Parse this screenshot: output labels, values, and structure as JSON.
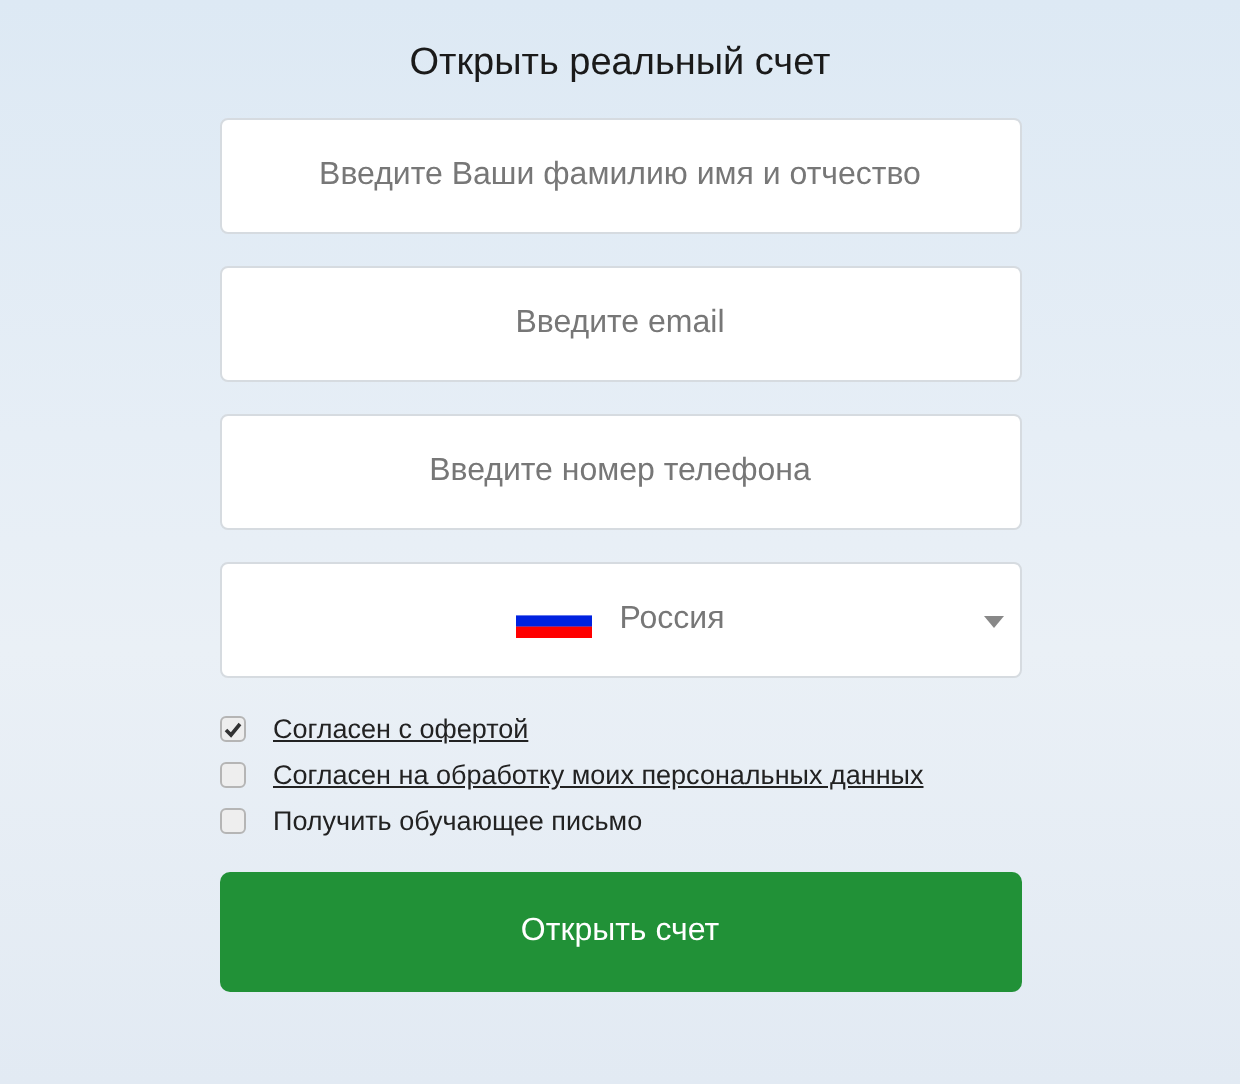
{
  "title": "Открыть реальный счет",
  "fields": [
    {
      "placeholder": "Введите Ваши фамилию имя и отчество"
    },
    {
      "placeholder": "Введите email"
    },
    {
      "placeholder": "Введите номер телефона"
    }
  ],
  "country_select": {
    "value": "Россия"
  },
  "agreements": [
    {
      "label": "Согласен с офертой",
      "checked": true,
      "kind": "link"
    },
    {
      "label": "Согласен на обработку моих персональных данных",
      "checked": false,
      "kind": "link"
    },
    {
      "label": "Получить обучающее письмо",
      "checked": false,
      "kind": "plain"
    }
  ],
  "submit_button": "Открыть счет"
}
